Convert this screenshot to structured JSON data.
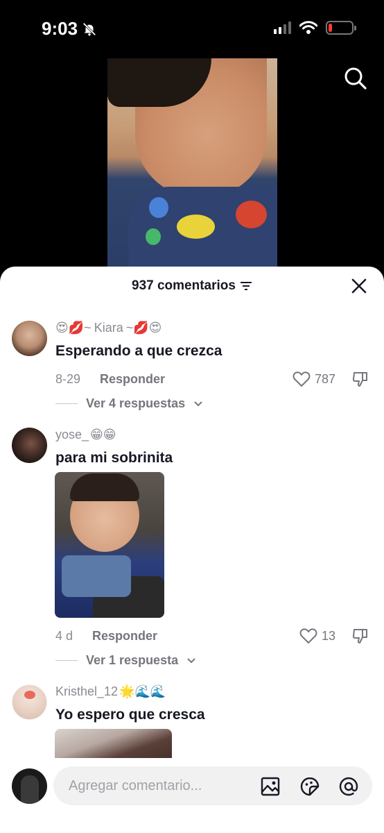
{
  "status_bar": {
    "time": "9:03",
    "battery_level": 0.15,
    "battery_color": "#ff3b30"
  },
  "video": {
    "search_icon": "search-icon"
  },
  "sheet": {
    "title": "937 comentarios",
    "filter_icon": "sort-filter-icon",
    "close_icon": "close-icon"
  },
  "comments": [
    {
      "username_prefix": "😍💋~",
      "username": "Kiara",
      "username_suffix": "~💋😍",
      "text": "Esperando a que crezca",
      "date": "8-29",
      "reply_label": "Responder",
      "likes": "787",
      "replies_label": "Ver 4 respuestas"
    },
    {
      "username": "yose_",
      "username_emojis": "😁😁",
      "text": "para mi sobrinita",
      "date": "4 d",
      "reply_label": "Responder",
      "likes": "13",
      "replies_label": "Ver 1 respuesta"
    },
    {
      "username": "Kristhel_12",
      "username_emojis": "🌟🌊🌊",
      "text": "Yo espero que cresca"
    }
  ],
  "input": {
    "placeholder": "Agregar comentario...",
    "icons": [
      "image-icon",
      "sticker-icon",
      "mention-icon"
    ]
  },
  "colors": {
    "text_primary": "#161823",
    "text_secondary": "#8a8b91",
    "sheet_bg": "#ffffff",
    "input_bg": "#f1f1f2"
  }
}
